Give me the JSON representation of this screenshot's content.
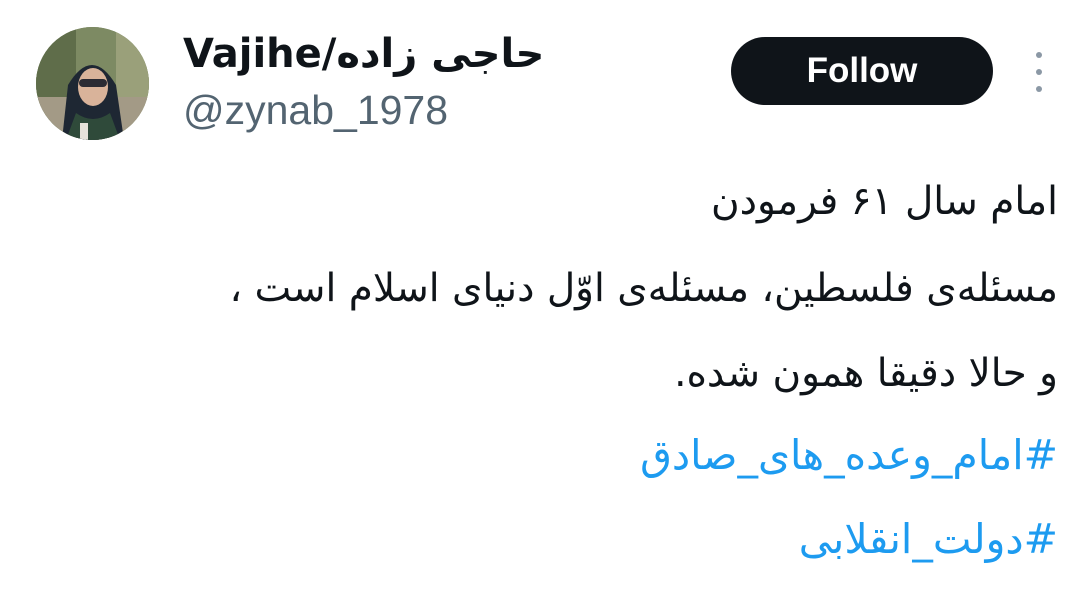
{
  "author": {
    "display_name": "Vajihe/حاجی زاده",
    "handle": "@zynab_1978",
    "avatar_icon": "profile-photo"
  },
  "actions": {
    "follow_label": "Follow",
    "more_icon": "more-vertical-icon"
  },
  "tweet": {
    "lines": [
      "امام سال ۶۱ فرمودن",
      "مسئله‌ی فلسطین، مسئله‌ی اوّل دنیای اسلام است ،",
      "و حالا دقیقا همون شده."
    ],
    "hashtags": [
      "#امام_وعده_های_صادق",
      "#دولت_انقلابی"
    ]
  },
  "colors": {
    "text": "#0f1419",
    "secondary": "#536471",
    "link": "#1d9bf0",
    "button_bg": "#0f1419",
    "button_text": "#ffffff"
  }
}
